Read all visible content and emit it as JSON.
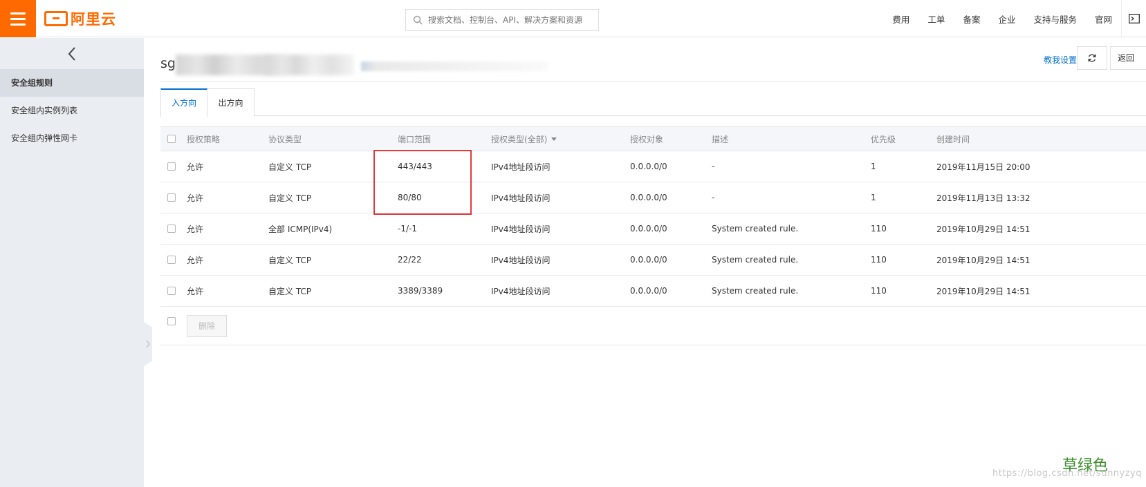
{
  "header": {
    "logo_text": "阿里云",
    "search_placeholder": "搜索文档、控制台、API、解决方案和资源",
    "nav": [
      "费用",
      "工单",
      "备案",
      "企业",
      "支持与服务",
      "官网"
    ]
  },
  "sidebar": {
    "items": [
      {
        "label": "安全组规则",
        "active": true
      },
      {
        "label": "安全组内实例列表",
        "active": false
      },
      {
        "label": "安全组内弹性网卡",
        "active": false
      }
    ]
  },
  "main": {
    "title_prefix": "sg",
    "help_link": "教我设置",
    "back_button": "返回",
    "tabs": [
      {
        "label": "入方向",
        "active": true
      },
      {
        "label": "出方向",
        "active": false
      }
    ]
  },
  "table": {
    "columns": [
      "授权策略",
      "协议类型",
      "端口范围",
      "授权类型(全部)",
      "授权对象",
      "描述",
      "优先级",
      "创建时间"
    ],
    "rows": [
      [
        "允许",
        "自定义 TCP",
        "443/443",
        "IPv4地址段访问",
        "0.0.0.0/0",
        "-",
        "1",
        "2019年11月15日 20:00"
      ],
      [
        "允许",
        "自定义 TCP",
        "80/80",
        "IPv4地址段访问",
        "0.0.0.0/0",
        "-",
        "1",
        "2019年11月13日 13:32"
      ],
      [
        "允许",
        "全部 ICMP(IPv4)",
        "-1/-1",
        "IPv4地址段访问",
        "0.0.0.0/0",
        "System created rule.",
        "110",
        "2019年10月29日 14:51"
      ],
      [
        "允许",
        "自定义 TCP",
        "22/22",
        "IPv4地址段访问",
        "0.0.0.0/0",
        "System created rule.",
        "110",
        "2019年10月29日 14:51"
      ],
      [
        "允许",
        "自定义 TCP",
        "3389/3389",
        "IPv4地址段访问",
        "0.0.0.0/0",
        "System created rule.",
        "110",
        "2019年10月29日 14:51"
      ]
    ],
    "delete_button": "删除"
  },
  "annotation": "草绿色",
  "watermark": "https://blog.csdn.net/sunnyzyq",
  "colors": {
    "brand": "#ff6a00",
    "link": "#0070cc",
    "highlight": "#e0393e",
    "annotation": "#3a8d2a"
  }
}
